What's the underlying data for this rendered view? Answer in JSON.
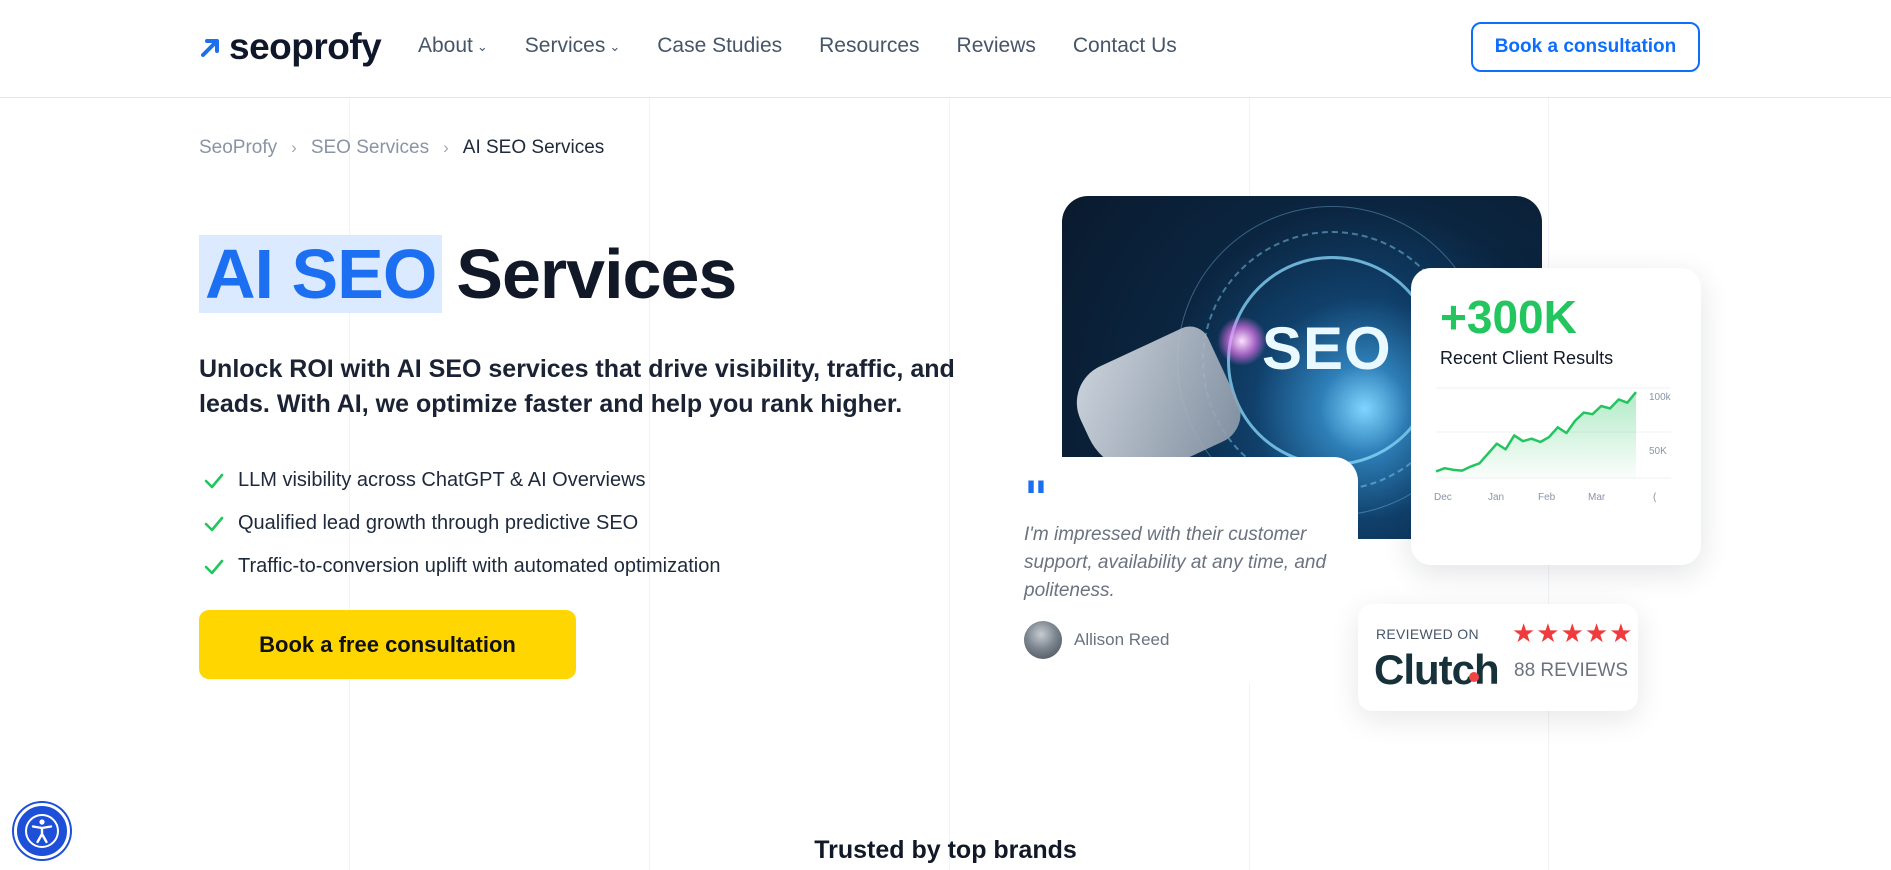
{
  "header": {
    "logo_text": "seoprofy",
    "nav": [
      {
        "label": "About",
        "has_dropdown": true
      },
      {
        "label": "Services",
        "has_dropdown": true
      },
      {
        "label": "Case Studies",
        "has_dropdown": false
      },
      {
        "label": "Resources",
        "has_dropdown": false
      },
      {
        "label": "Reviews",
        "has_dropdown": false
      },
      {
        "label": "Contact Us",
        "has_dropdown": false
      }
    ],
    "cta_label": "Book a consultation"
  },
  "breadcrumb": {
    "items": [
      "SeoProfy",
      "SEO Services"
    ],
    "current": "AI SEO Services",
    "separator": "›"
  },
  "hero": {
    "title_highlight": "AI SEO",
    "title_rest": "Services",
    "subtitle": "Unlock ROI with AI SEO services that drive visibility, traffic, and leads. With AI, we optimize faster and help you rank higher.",
    "bullets": [
      "LLM visibility across ChatGPT & AI Overviews",
      "Qualified lead growth through predictive SEO",
      "Traffic-to-conversion uplift with automated optimization"
    ],
    "cta_label": "Book a free consultation"
  },
  "visual": {
    "image_text": "SEO"
  },
  "results_card": {
    "value": "+300K",
    "label": "Recent Client Results"
  },
  "chart_data": {
    "type": "area",
    "title": "",
    "x_tick_labels": [
      "Dec",
      "Jan",
      "Feb",
      "Mar",
      "("
    ],
    "y_tick_labels": [
      "100k",
      "50K"
    ],
    "series": [
      {
        "values": [
          8,
          12,
          10,
          9,
          14,
          18,
          30,
          42,
          35,
          52,
          45,
          48,
          44,
          50,
          62,
          55,
          70,
          80,
          78,
          88,
          85,
          96,
          92,
          105
        ]
      }
    ],
    "grid": true,
    "color": "#22c55e"
  },
  "quote": {
    "mark": "\"",
    "text": "I'm impressed with their customer support, availability at any time, and politeness.",
    "author": "Allison Reed"
  },
  "clutch": {
    "reviewed_on": "REVIEWED ON",
    "logo": "Clutch",
    "stars": "★★★★★",
    "rating": 5,
    "reviews": "88 REVIEWS"
  },
  "trusted_heading": "Trusted by top brands",
  "colors": {
    "brand_blue": "#1d6ff2",
    "cta_yellow": "#ffd600",
    "success_green": "#22c55e",
    "star_red": "#ef3b3b"
  }
}
